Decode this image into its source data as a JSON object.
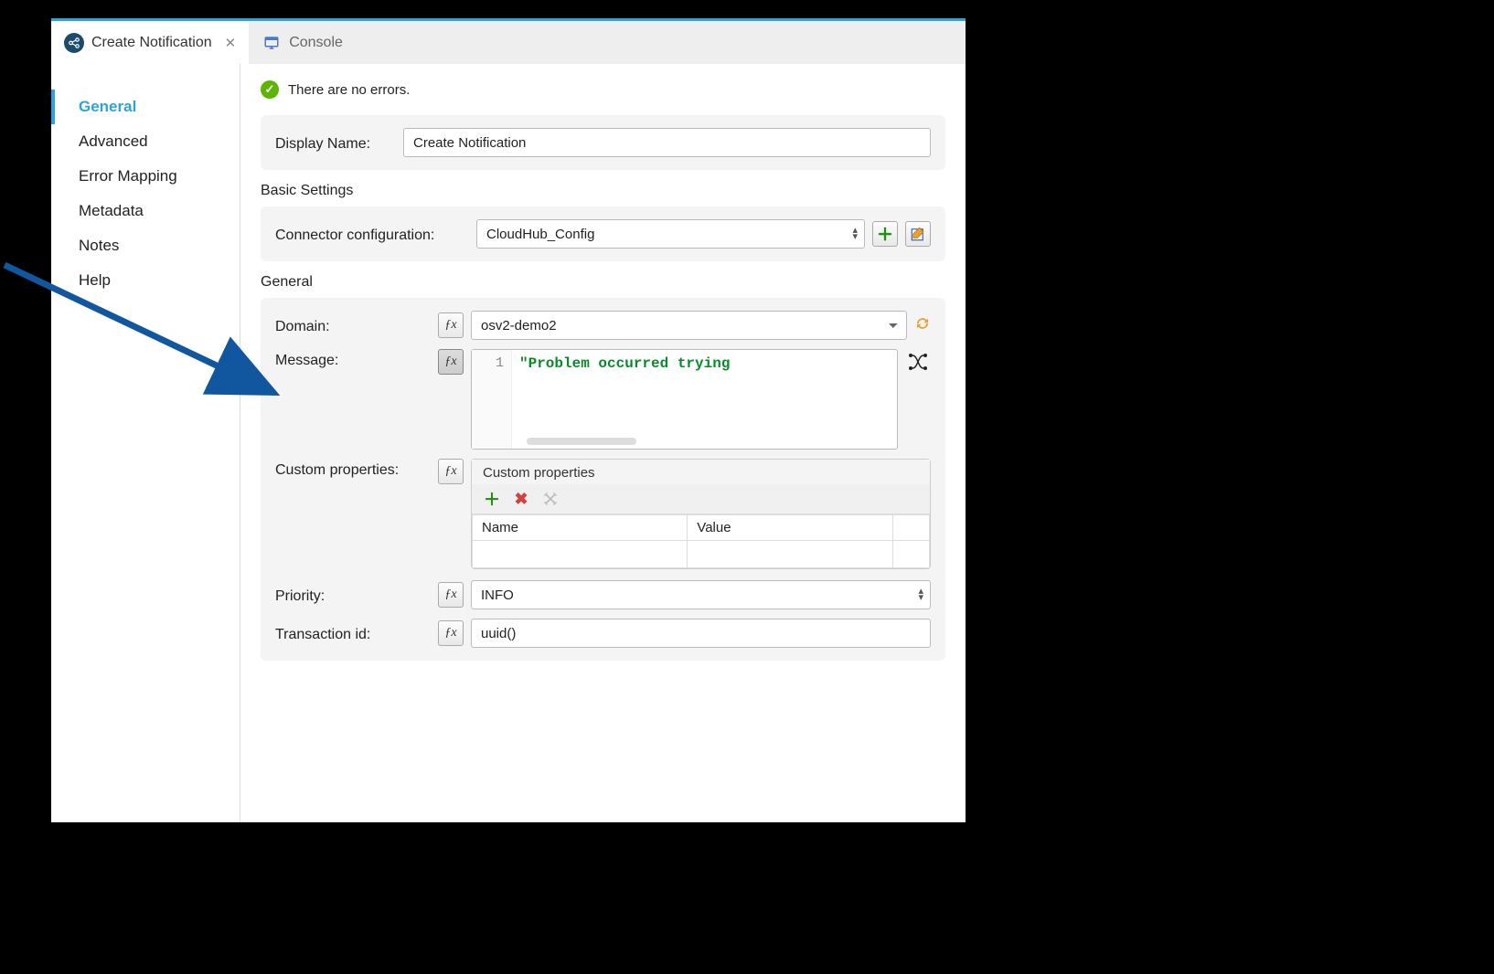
{
  "tabs": {
    "active": {
      "label": "Create Notification"
    },
    "console": {
      "label": "Console"
    }
  },
  "sidebar": {
    "items": [
      "General",
      "Advanced",
      "Error Mapping",
      "Metadata",
      "Notes",
      "Help"
    ]
  },
  "status": {
    "message": "There are no errors."
  },
  "displayName": {
    "label": "Display Name:",
    "value": "Create Notification"
  },
  "basic": {
    "title": "Basic Settings",
    "connector_label": "Connector configuration:",
    "connector_value": "CloudHub_Config"
  },
  "general": {
    "title": "General",
    "domain_label": "Domain:",
    "domain_value": "osv2-demo2",
    "message_label": "Message:",
    "message_line": "1",
    "message_code": "\"Problem occurred trying",
    "custom_label": "Custom properties:",
    "custom_title": "Custom properties",
    "custom_cols": {
      "name": "Name",
      "value": "Value"
    },
    "priority_label": "Priority:",
    "priority_value": "INFO",
    "txid_label": "Transaction id:",
    "txid_value": "uuid()"
  }
}
